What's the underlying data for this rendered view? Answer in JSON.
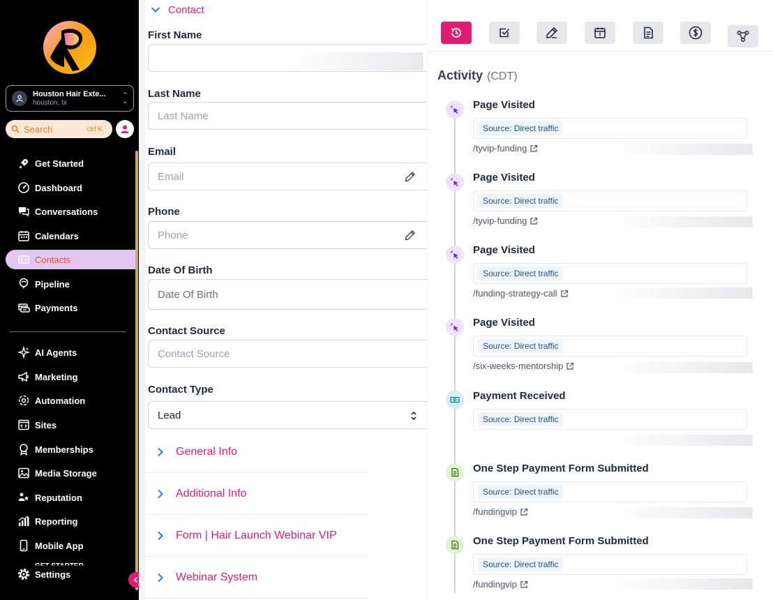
{
  "sidebar": {
    "account": {
      "name": "Houston Hair Exte...",
      "location": "houston, tx"
    },
    "search": {
      "placeholder": "Search",
      "shortcut": "ctrl K"
    },
    "nav_main": [
      {
        "label": "Get Started",
        "icon": "rocket-icon"
      },
      {
        "label": "Dashboard",
        "icon": "gauge-icon"
      },
      {
        "label": "Conversations",
        "icon": "chat-icon"
      },
      {
        "label": "Calendars",
        "icon": "calendar-icon"
      },
      {
        "label": "Contacts",
        "icon": "contact-card-icon",
        "active": true
      },
      {
        "label": "Pipeline",
        "icon": "funnel-icon"
      },
      {
        "label": "Payments",
        "icon": "payments-icon"
      }
    ],
    "nav_secondary": [
      {
        "label": "AI Agents",
        "icon": "sparkle-icon"
      },
      {
        "label": "Marketing",
        "icon": "megaphone-icon"
      },
      {
        "label": "Automation",
        "icon": "automation-icon"
      },
      {
        "label": "Sites",
        "icon": "code-window-icon"
      },
      {
        "label": "Memberships",
        "icon": "badge-icon"
      },
      {
        "label": "Media Storage",
        "icon": "image-icon"
      },
      {
        "label": "Reputation",
        "icon": "reputation-icon"
      },
      {
        "label": "Reporting",
        "icon": "chart-icon"
      },
      {
        "label": "Mobile App",
        "icon": "mobile-icon"
      },
      {
        "label": "Settings",
        "icon": "gear-icon"
      }
    ],
    "settings_overlap_text": "GET STARTED",
    "accent_color": "#e11d73"
  },
  "contact_form": {
    "section_title": "Contact",
    "fields": [
      {
        "label": "First Name",
        "placeholder": "",
        "value": ""
      },
      {
        "label": "Last Name",
        "placeholder": "Last Name"
      },
      {
        "label": "Email",
        "placeholder": "Email"
      },
      {
        "label": "Phone",
        "placeholder": "Phone"
      },
      {
        "label": "Date Of Birth",
        "placeholder": "Date Of Birth"
      },
      {
        "label": "Contact Source",
        "placeholder": "Contact Source"
      },
      {
        "label": "Contact Type",
        "value": "Lead"
      }
    ],
    "sections": [
      "General Info",
      "Additional Info",
      "Form | Hair Launch Webinar VIP",
      "Webinar System"
    ]
  },
  "activity": {
    "title": "Activity",
    "timezone": "(CDT)",
    "tabs": [
      "activity-clock-icon",
      "task-check-icon",
      "note-pen-icon",
      "appointment-calendar-icon",
      "document-icon",
      "dollar-icon",
      "workflow-icon"
    ],
    "events": [
      {
        "type": "page",
        "title": "Page Visited",
        "source": "Source: Direct traffic",
        "link": "/tyvip-funding"
      },
      {
        "type": "page",
        "title": "Page Visited",
        "source": "Source: Direct traffic",
        "link": "/tyvip-funding"
      },
      {
        "type": "page",
        "title": "Page Visited",
        "source": "Source: Direct traffic",
        "link": "/funding-strategy-call"
      },
      {
        "type": "page",
        "title": "Page Visited",
        "source": "Source: Direct traffic",
        "link": "/six-weeks-mentorship"
      },
      {
        "type": "payment",
        "title": "Payment Received",
        "source": "Source: Direct traffic",
        "link": ""
      },
      {
        "type": "form",
        "title": "One Step Payment Form Submitted",
        "source": "Source: Direct traffic",
        "link": "/fundingvip"
      },
      {
        "type": "form",
        "title": "One Step Payment Form Submitted",
        "source": "Source: Direct traffic",
        "link": "/fundingvip"
      }
    ]
  }
}
